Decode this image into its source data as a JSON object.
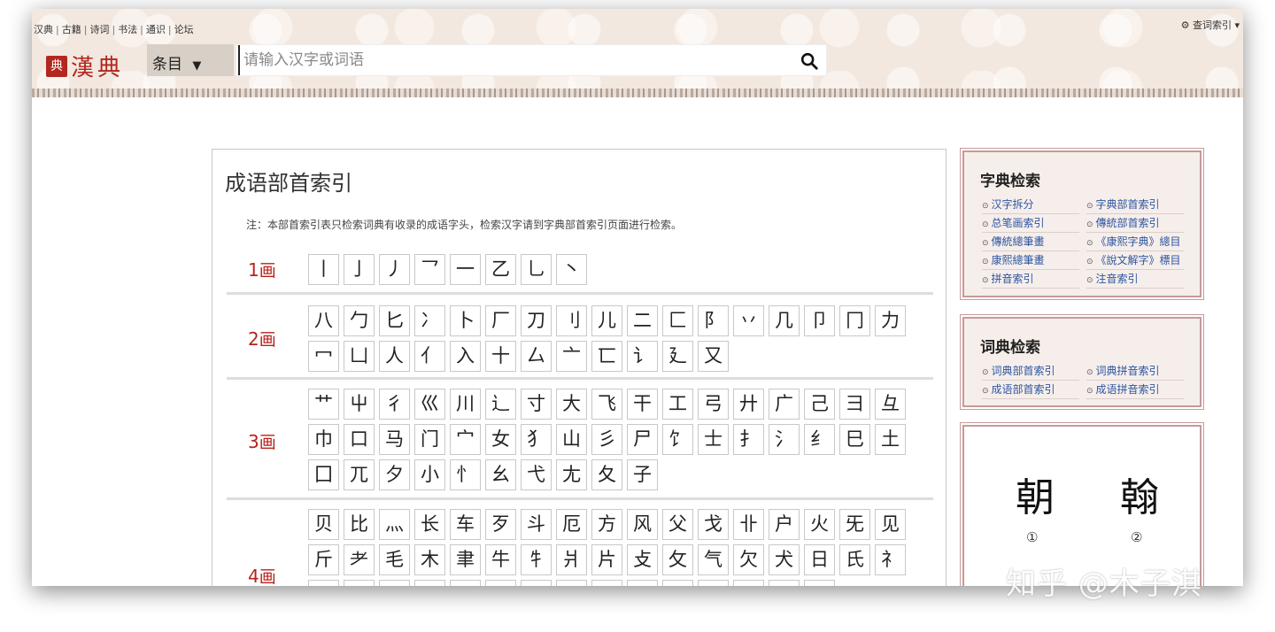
{
  "header": {
    "nav": [
      "汉典",
      "古籍",
      "诗词",
      "书法",
      "通识",
      "论坛"
    ],
    "query_index": "查词索引",
    "logo_seal": "典",
    "logo_text": "漢典",
    "select_value": "条目",
    "search_placeholder": "请输入汉字或词语"
  },
  "main": {
    "title": "成语部首索引",
    "note": "注：本部首索引表只检索词典有收录的成语字头，检索汉字请到字典部首索引页面进行检索。",
    "stroke_groups": [
      {
        "num": "1",
        "unit": "画",
        "radicals": [
          "丨",
          "亅",
          "丿",
          "乛",
          "一",
          "乙",
          "乚",
          "丶"
        ]
      },
      {
        "num": "2",
        "unit": "画",
        "radicals": [
          "八",
          "勹",
          "匕",
          "冫",
          "卜",
          "厂",
          "刀",
          "刂",
          "儿",
          "二",
          "匚",
          "阝",
          "丷",
          "几",
          "卩",
          "冂",
          "力",
          "冖",
          "凵",
          "人",
          "亻",
          "入",
          "十",
          "厶",
          "亠",
          "匸",
          "讠",
          "廴",
          "又"
        ]
      },
      {
        "num": "3",
        "unit": "画",
        "radicals": [
          "艹",
          "屮",
          "彳",
          "巛",
          "川",
          "辶",
          "寸",
          "大",
          "飞",
          "干",
          "工",
          "弓",
          "廾",
          "广",
          "己",
          "彐",
          "彑",
          "巾",
          "口",
          "马",
          "门",
          "宀",
          "女",
          "犭",
          "山",
          "彡",
          "尸",
          "饣",
          "士",
          "扌",
          "氵",
          "纟",
          "巳",
          "土",
          "囗",
          "兀",
          "夕",
          "小",
          "忄",
          "幺",
          "弋",
          "尢",
          "夂",
          "子"
        ]
      },
      {
        "num": "4",
        "unit": "画",
        "radicals": [
          "贝",
          "比",
          "灬",
          "长",
          "车",
          "歹",
          "斗",
          "厄",
          "方",
          "风",
          "父",
          "戈",
          "卝",
          "户",
          "火",
          "旡",
          "见",
          "斤",
          "耂",
          "毛",
          "木",
          "聿",
          "牛",
          "牜",
          "爿",
          "片",
          "攴",
          "攵",
          "气",
          "欠",
          "犬",
          "日",
          "氏",
          "礻",
          "",
          "",
          "",
          "",
          "",
          "",
          "",
          "",
          "",
          "",
          "",
          "",
          "",
          "",
          ""
        ]
      }
    ]
  },
  "sidebar": {
    "zidian": {
      "title": "字典检索",
      "links": [
        "汉字拆分",
        "字典部首索引",
        "总笔画索引",
        "傳統部首索引",
        "傳統總筆畫",
        "《康熙字典》總目",
        "康熙總筆畫",
        "《說文解字》標目",
        "拼音索引",
        "注音索引"
      ]
    },
    "cidian": {
      "title": "词典检索",
      "links": [
        "词典部首索引",
        "词典拼音索引",
        "成语部首索引",
        "成语拼音索引"
      ]
    },
    "seal_image": {
      "glyphs": [
        "朝",
        "翰"
      ],
      "labels": [
        "①",
        "②"
      ]
    }
  },
  "watermark": "知乎 @木子淇",
  "colors": {
    "accent_red": "#b2271f",
    "link_blue": "#2d56a0",
    "sidebar_border": "#c79a9a",
    "header_bg": "#f3e8df"
  }
}
